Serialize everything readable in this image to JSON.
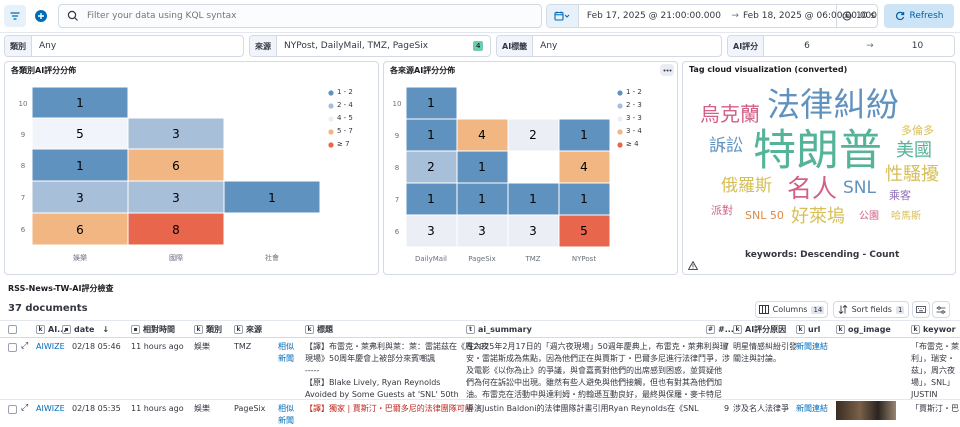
{
  "query": {
    "placeholder": "Filter your data using KQL syntax",
    "date_start": "Feb 17, 2025 @ 21:00:00.000",
    "date_end": "Feb 18, 2025 @ 06:00:00.000",
    "interval": "10 s",
    "refresh_label": "Refresh"
  },
  "filters": [
    {
      "label": "類別",
      "value": "Any"
    },
    {
      "label": "來源",
      "value": "NYPost, DailyMail, TMZ, PageSix",
      "count": "4"
    },
    {
      "label": "AI標籤",
      "value": "Any"
    },
    {
      "label": "AI評分",
      "min": "6",
      "max": "10"
    }
  ],
  "heatmap1": {
    "title": "各類別AI評分分佈",
    "legend": [
      "1 - 2",
      "2 - 4",
      "4 - 5",
      "5 - 7",
      "≥ 7"
    ]
  },
  "heatmap2": {
    "title": "各來源AI評分分佈",
    "legend": [
      "1 - 2",
      "2 - 3",
      "3 - 3",
      "3 - 4",
      "≥ 4"
    ]
  },
  "tagcloud": {
    "title": "Tag cloud visualization (converted)",
    "footer": "keywords: Descending - Count",
    "tags": [
      {
        "text": "法律糾紛",
        "color": "#6092c0"
      },
      {
        "text": "烏克蘭",
        "color": "#d36086"
      },
      {
        "text": "訴訟",
        "color": "#6092c0"
      },
      {
        "text": "特朗普",
        "color": "#54b399"
      },
      {
        "text": "多倫多",
        "color": "#d6bf57"
      },
      {
        "text": "美國",
        "color": "#54b399"
      },
      {
        "text": "俄羅斯",
        "color": "#d6bf57"
      },
      {
        "text": "名人",
        "color": "#d36086"
      },
      {
        "text": "SNL",
        "color": "#6092c0"
      },
      {
        "text": "性騷擾",
        "color": "#d6bf57"
      },
      {
        "text": "乘客",
        "color": "#9170b8"
      },
      {
        "text": "派對",
        "color": "#d36086"
      },
      {
        "text": "SNL 50",
        "color": "#da8b45"
      },
      {
        "text": "好萊塢",
        "color": "#d6bf57"
      },
      {
        "text": "公園",
        "color": "#d36086"
      },
      {
        "text": "哈馬斯",
        "color": "#d6bf57"
      }
    ]
  },
  "table": {
    "title": "RSS-News-TW-AI評分檢查",
    "doc_count": "37 documents",
    "columns_label": "Columns",
    "columns_count": "14",
    "sort_label": "Sort fields",
    "sort_count": "1",
    "headers": [
      "AI...",
      "date",
      "相對時間",
      "類別",
      "來源",
      "標題",
      "ai_summary",
      "#...",
      "AI評分原因",
      "url",
      "og_image",
      "keywor"
    ],
    "rows": [
      {
        "ai": "AIWIZE",
        "date": "02/18 05:46",
        "rel": "11 hours ago",
        "cat": "娛樂",
        "src": "TMZ",
        "link1": "相似",
        "link2": "新聞",
        "title1": "【譯】布雷克・萊弗利與萊：萊：雷諾茲在《周六夜",
        "title2": "現場》50周年慶會上被部分來賓嘲諷",
        "title3": "-----",
        "title4": "【原】Blake Lively, Ryan Reynolds",
        "title5": "Avoided by Some Guests at 'SNL' 50th",
        "sum1": "在2025年2月17日的「週六夜現場」50週年慶典上，布雷克・萊弗利與瑞",
        "sum2": "安・雷諾斯成為焦點，因為他們正在與賈斯丁・巴爾多尼進行法律鬥爭，涉",
        "sum3": "及電影《以你為止》的爭議，與會嘉賓對他們的出席感到困惑，並質疑他",
        "sum4": "們為何在訴訟中出現。雖然有些人避免與他們接觸，但也有對其為他們加",
        "sum5": "油。布雷克在活動中與達利姆・約翰遜互動良好，最終與保羅・麥卡特尼",
        "score": "7",
        "reason1": "明星情感糾紛引發",
        "reason2": "關注與討論。",
        "url": "新聞連結",
        "kw1": "「布雷克・萊",
        "kw2": "利」，瑞安・",
        "kw3": "茲」，周六夜",
        "kw4": "場」，SNL」",
        "kw5": "JUSTIN"
      },
      {
        "ai": "AIWIZE",
        "date": "02/18 05:35",
        "rel": "11 hours ago",
        "cat": "娛樂",
        "src": "PageSix",
        "link1": "相似",
        "link2": "新聞",
        "title1": "【譯】獨家 | 賈斯汀・巴爾多尼的法律團隊可能",
        "sum1": "導演Justin Baldoni的法律團隊計畫引用Ryan Reynolds在《SNL",
        "score": "9",
        "reason1": "涉及名人法律爭",
        "url": "新聞連結",
        "kw1": "「賈斯汀・巴"
      }
    ]
  }
}
